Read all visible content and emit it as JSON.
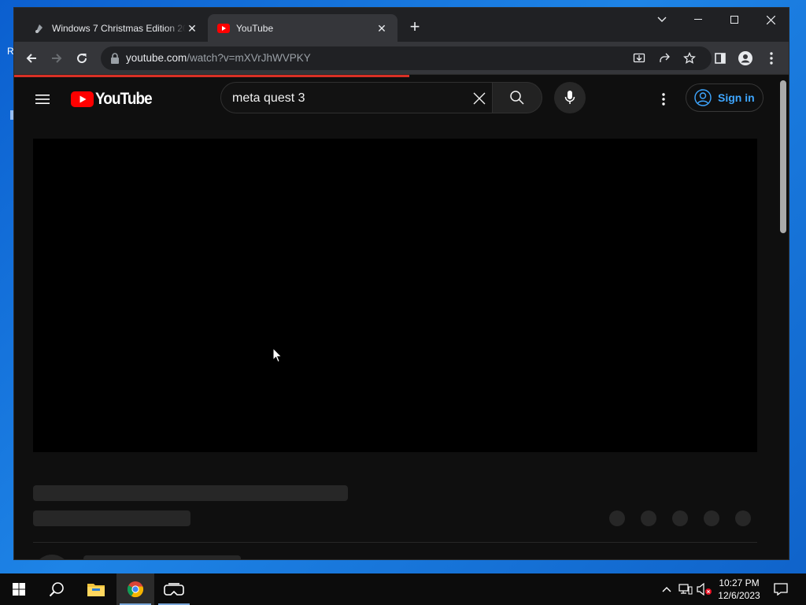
{
  "desktop": {
    "fragment_r": "R"
  },
  "browser": {
    "tabs": [
      {
        "title": "Windows 7 Christmas Edition 20",
        "active": false,
        "icon": "ornament-icon"
      },
      {
        "title": "YouTube",
        "active": true,
        "icon": "youtube-favicon-icon"
      }
    ],
    "url_host": "youtube.com",
    "url_path": "/watch?v=mXVrJhWVPKY",
    "load_progress": 0.51
  },
  "youtube": {
    "logo_text": "YouTube",
    "search_value": "meta quest 3",
    "search_placeholder": "Search",
    "sign_in_label": "Sign in",
    "accent": "#ff0000",
    "link_color": "#3ea6ff"
  },
  "taskbar": {
    "time": "10:27 PM",
    "date": "12/6/2023",
    "apps": [
      "start-icon",
      "search-icon",
      "file-explorer-icon",
      "chrome-icon",
      "vr-headset-icon"
    ]
  }
}
